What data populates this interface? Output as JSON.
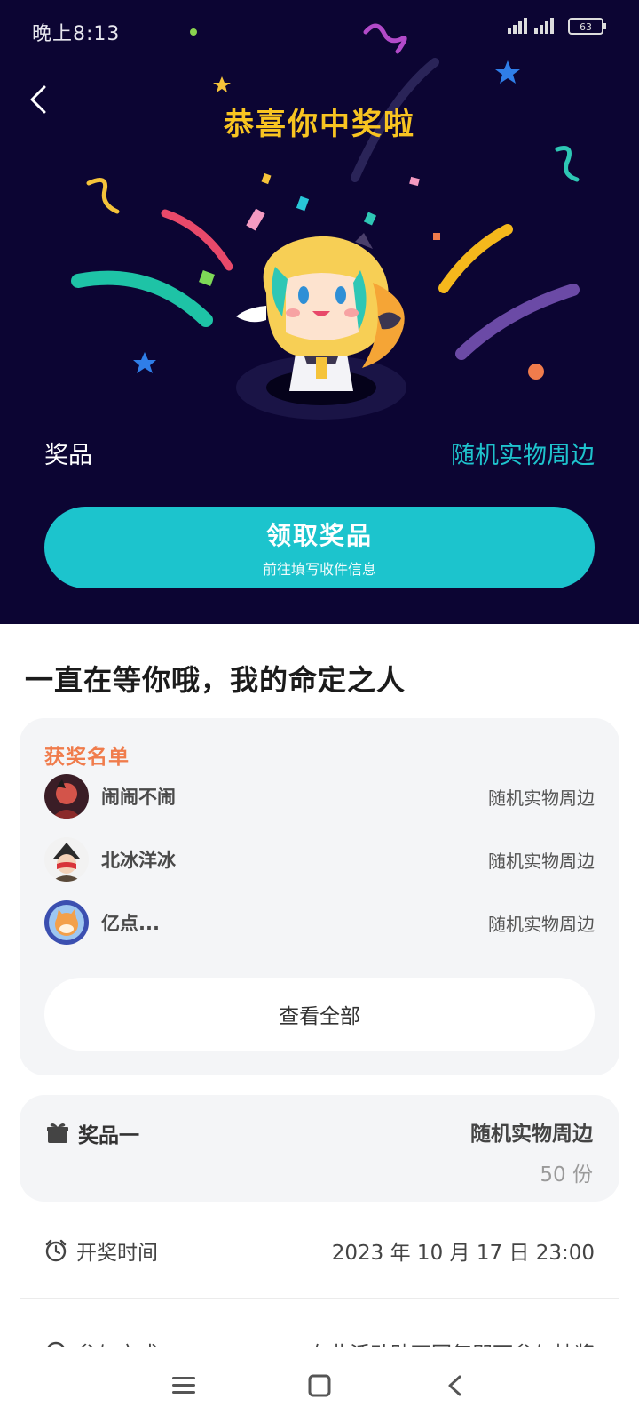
{
  "status_bar": {
    "time": "晚上8:13",
    "battery": "63"
  },
  "hero": {
    "title": "恭喜你中奖啦",
    "prize_label": "奖品",
    "prize_value": "随机实物周边",
    "claim_button": {
      "label": "领取奖品",
      "sublabel": "前往填写收件信息"
    }
  },
  "heading": "一直在等你哦，我的命定之人",
  "winners": {
    "title": "获奖名单",
    "items": [
      {
        "name": "闹闹不闹",
        "prize": "随机实物周边"
      },
      {
        "name": "北冰洋冰",
        "prize": "随机实物周边"
      },
      {
        "name": "亿点...",
        "prize": "随机实物周边"
      }
    ],
    "view_all": "查看全部"
  },
  "prize_item": {
    "name": "奖品一",
    "value": "随机实物周边",
    "count": "50 份"
  },
  "draw_time": {
    "label": "开奖时间",
    "value": "2023 年 10 月 17 日 23:00"
  },
  "participation": {
    "label": "参与方式",
    "value": "在此活动贴下回复即可参与抽奖"
  },
  "colors": {
    "hero_bg": "#0c0533",
    "accent": "#1cc4cd",
    "title_yellow": "#f8c421",
    "winners_orange": "#f07c4c"
  }
}
